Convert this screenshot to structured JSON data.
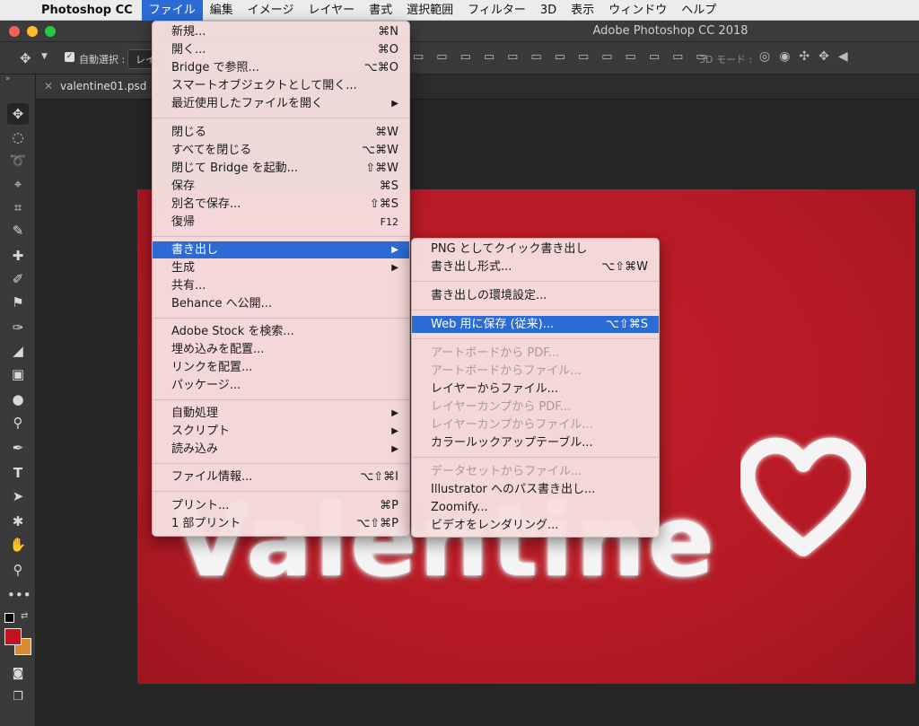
{
  "menubar": {
    "app_name": "Photoshop CC",
    "items": [
      "ファイル",
      "編集",
      "イメージ",
      "レイヤー",
      "書式",
      "選択範囲",
      "フィルター",
      "3D",
      "表示",
      "ウィンドウ",
      "ヘルプ"
    ]
  },
  "window": {
    "title": "Adobe Photoshop CC 2018"
  },
  "options_bar": {
    "auto_select_label": "自動選択 :",
    "layer_dropdown": "レイ",
    "mode_3d_label": "3D モード :"
  },
  "document": {
    "tab_name": "valentine01.psd",
    "canvas_text": "Valentine"
  },
  "colors": {
    "menu_highlight": "#2a6bd6",
    "canvas_red": "#b51a25",
    "foreground": "#c0141e",
    "background": "#d98a2c"
  },
  "file_menu": {
    "items": [
      {
        "label": "新規...",
        "shortcut": "⌘N"
      },
      {
        "label": "開く...",
        "shortcut": "⌘O"
      },
      {
        "label": "Bridge で参照...",
        "shortcut": "⌥⌘O"
      },
      {
        "label": "スマートオブジェクトとして開く...",
        "shortcut": ""
      },
      {
        "label": "最近使用したファイルを開く",
        "shortcut": "▶"
      },
      {
        "label": "閉じる",
        "shortcut": "⌘W"
      },
      {
        "label": "すべてを閉じる",
        "shortcut": "⌥⌘W"
      },
      {
        "label": "閉じて Bridge を起動...",
        "shortcut": "⇧⌘W"
      },
      {
        "label": "保存",
        "shortcut": "⌘S"
      },
      {
        "label": "別名で保存...",
        "shortcut": "⇧⌘S"
      },
      {
        "label": "復帰",
        "shortcut": "F12"
      },
      {
        "label": "書き出し",
        "shortcut": "▶"
      },
      {
        "label": "生成",
        "shortcut": "▶"
      },
      {
        "label": "共有...",
        "shortcut": ""
      },
      {
        "label": "Behance へ公開...",
        "shortcut": ""
      },
      {
        "label": "Adobe Stock を検索...",
        "shortcut": ""
      },
      {
        "label": "埋め込みを配置...",
        "shortcut": ""
      },
      {
        "label": "リンクを配置...",
        "shortcut": ""
      },
      {
        "label": "パッケージ...",
        "shortcut": ""
      },
      {
        "label": "自動処理",
        "shortcut": "▶"
      },
      {
        "label": "スクリプト",
        "shortcut": "▶"
      },
      {
        "label": "読み込み",
        "shortcut": "▶"
      },
      {
        "label": "ファイル情報...",
        "shortcut": "⌥⇧⌘I"
      },
      {
        "label": "プリント...",
        "shortcut": "⌘P"
      },
      {
        "label": "1 部プリント",
        "shortcut": "⌥⇧⌘P"
      }
    ]
  },
  "export_submenu": {
    "items": [
      {
        "label": "PNG としてクイック書き出し",
        "shortcut": ""
      },
      {
        "label": "書き出し形式...",
        "shortcut": "⌥⇧⌘W"
      },
      {
        "label": "書き出しの環境設定...",
        "shortcut": ""
      },
      {
        "label": "Web 用に保存 (従来)...",
        "shortcut": "⌥⇧⌘S"
      },
      {
        "label": "アートボードから PDF...",
        "shortcut": ""
      },
      {
        "label": "アートボードからファイル...",
        "shortcut": ""
      },
      {
        "label": "レイヤーからファイル...",
        "shortcut": ""
      },
      {
        "label": "レイヤーカンプから PDF...",
        "shortcut": ""
      },
      {
        "label": "レイヤーカンプからファイル...",
        "shortcut": ""
      },
      {
        "label": "カラールックアップテーブル...",
        "shortcut": ""
      },
      {
        "label": "データセットからファイル...",
        "shortcut": ""
      },
      {
        "label": "Illustrator へのパス書き出し...",
        "shortcut": ""
      },
      {
        "label": "Zoomify...",
        "shortcut": ""
      },
      {
        "label": "ビデオをレンダリング...",
        "shortcut": ""
      }
    ]
  }
}
